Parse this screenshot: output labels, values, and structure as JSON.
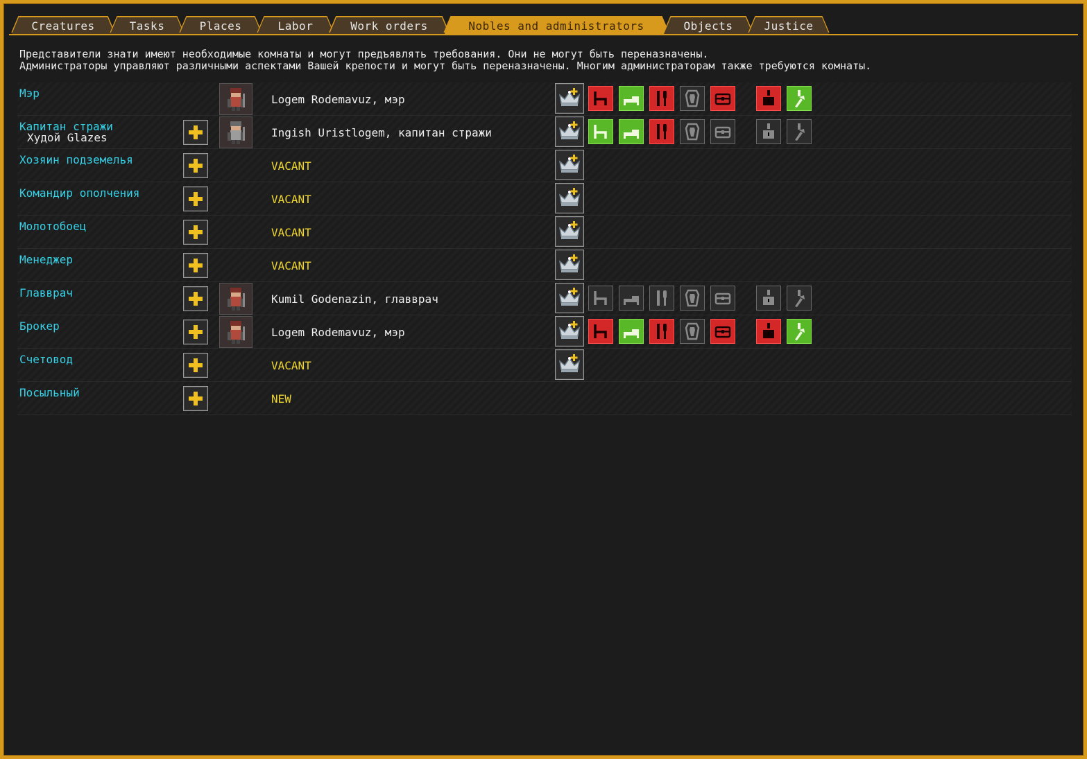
{
  "tabs": [
    {
      "label": "Creatures",
      "active": false
    },
    {
      "label": "Tasks",
      "active": false
    },
    {
      "label": "Places",
      "active": false
    },
    {
      "label": "Labor",
      "active": false
    },
    {
      "label": "Work orders",
      "active": false
    },
    {
      "label": "Nobles and administrators",
      "active": true
    },
    {
      "label": "Objects",
      "active": false
    },
    {
      "label": "Justice",
      "active": false
    }
  ],
  "description": {
    "line1": "Представители знати имеют необходимые комнаты и могут предъявлять требования. Они не могут быть переназначены.",
    "line2": "Администраторы управляют различными аспектами Вашей крепости и могут быть переназначены. Многим администраторам также требуются комнаты."
  },
  "rows": [
    {
      "position": "Мэр",
      "sub": "",
      "holder": "Logem Rodemavuz, мэр",
      "vacant": false,
      "portrait": "dwarf-red-beard",
      "reqs": [
        "red",
        "green",
        "red",
        "gray",
        "red",
        "red",
        "green"
      ]
    },
    {
      "position": "Капитан стражи",
      "sub": "Худой Glazes",
      "holder": "Ingish Uristlogem, капитан стражи",
      "vacant": false,
      "portrait": "dwarf-gray-helmet",
      "reqs": [
        "green",
        "green",
        "red",
        "gray",
        "gray",
        "gray",
        "gray"
      ]
    },
    {
      "position": "Хозяин подземелья",
      "sub": "",
      "holder": "VACANT",
      "vacant": true,
      "portrait": "",
      "reqs": []
    },
    {
      "position": "Командир ополчения",
      "sub": "",
      "holder": "VACANT",
      "vacant": true,
      "portrait": "",
      "reqs": []
    },
    {
      "position": "Молотобоец",
      "sub": "",
      "holder": "VACANT",
      "vacant": true,
      "portrait": "",
      "reqs": []
    },
    {
      "position": "Менеджер",
      "sub": "",
      "holder": "VACANT",
      "vacant": true,
      "portrait": "",
      "reqs": []
    },
    {
      "position": "Главврач",
      "sub": "",
      "holder": "Kumil Godenazin, главврач",
      "vacant": false,
      "portrait": "dwarf-red-hair",
      "reqs": [
        "gray",
        "gray",
        "gray",
        "gray",
        "gray",
        "gray",
        "gray"
      ]
    },
    {
      "position": "Брокер",
      "sub": "",
      "holder": "Logem Rodemavuz, мэр",
      "vacant": false,
      "portrait": "dwarf-red-beard",
      "reqs": [
        "red",
        "green",
        "red",
        "gray",
        "red",
        "red",
        "green"
      ]
    },
    {
      "position": "Счетовод",
      "sub": "",
      "holder": "VACANT",
      "vacant": true,
      "portrait": "",
      "reqs": []
    },
    {
      "position": "Посыльный",
      "sub": "",
      "holder": "NEW",
      "vacant": true,
      "portrait": "",
      "reqs": [],
      "no_crown": true
    }
  ],
  "req_icons": [
    "chair-icon",
    "bed-icon",
    "dining-icon",
    "tomb-icon",
    "chest-icon",
    "cabinet-icon",
    "weapon-rack-icon"
  ],
  "colors": {
    "accent": "#d89a1c",
    "position_text": "#36d2e8",
    "vacant_text": "#f0d830",
    "req_red": "#d42828",
    "req_green": "#58b828"
  }
}
